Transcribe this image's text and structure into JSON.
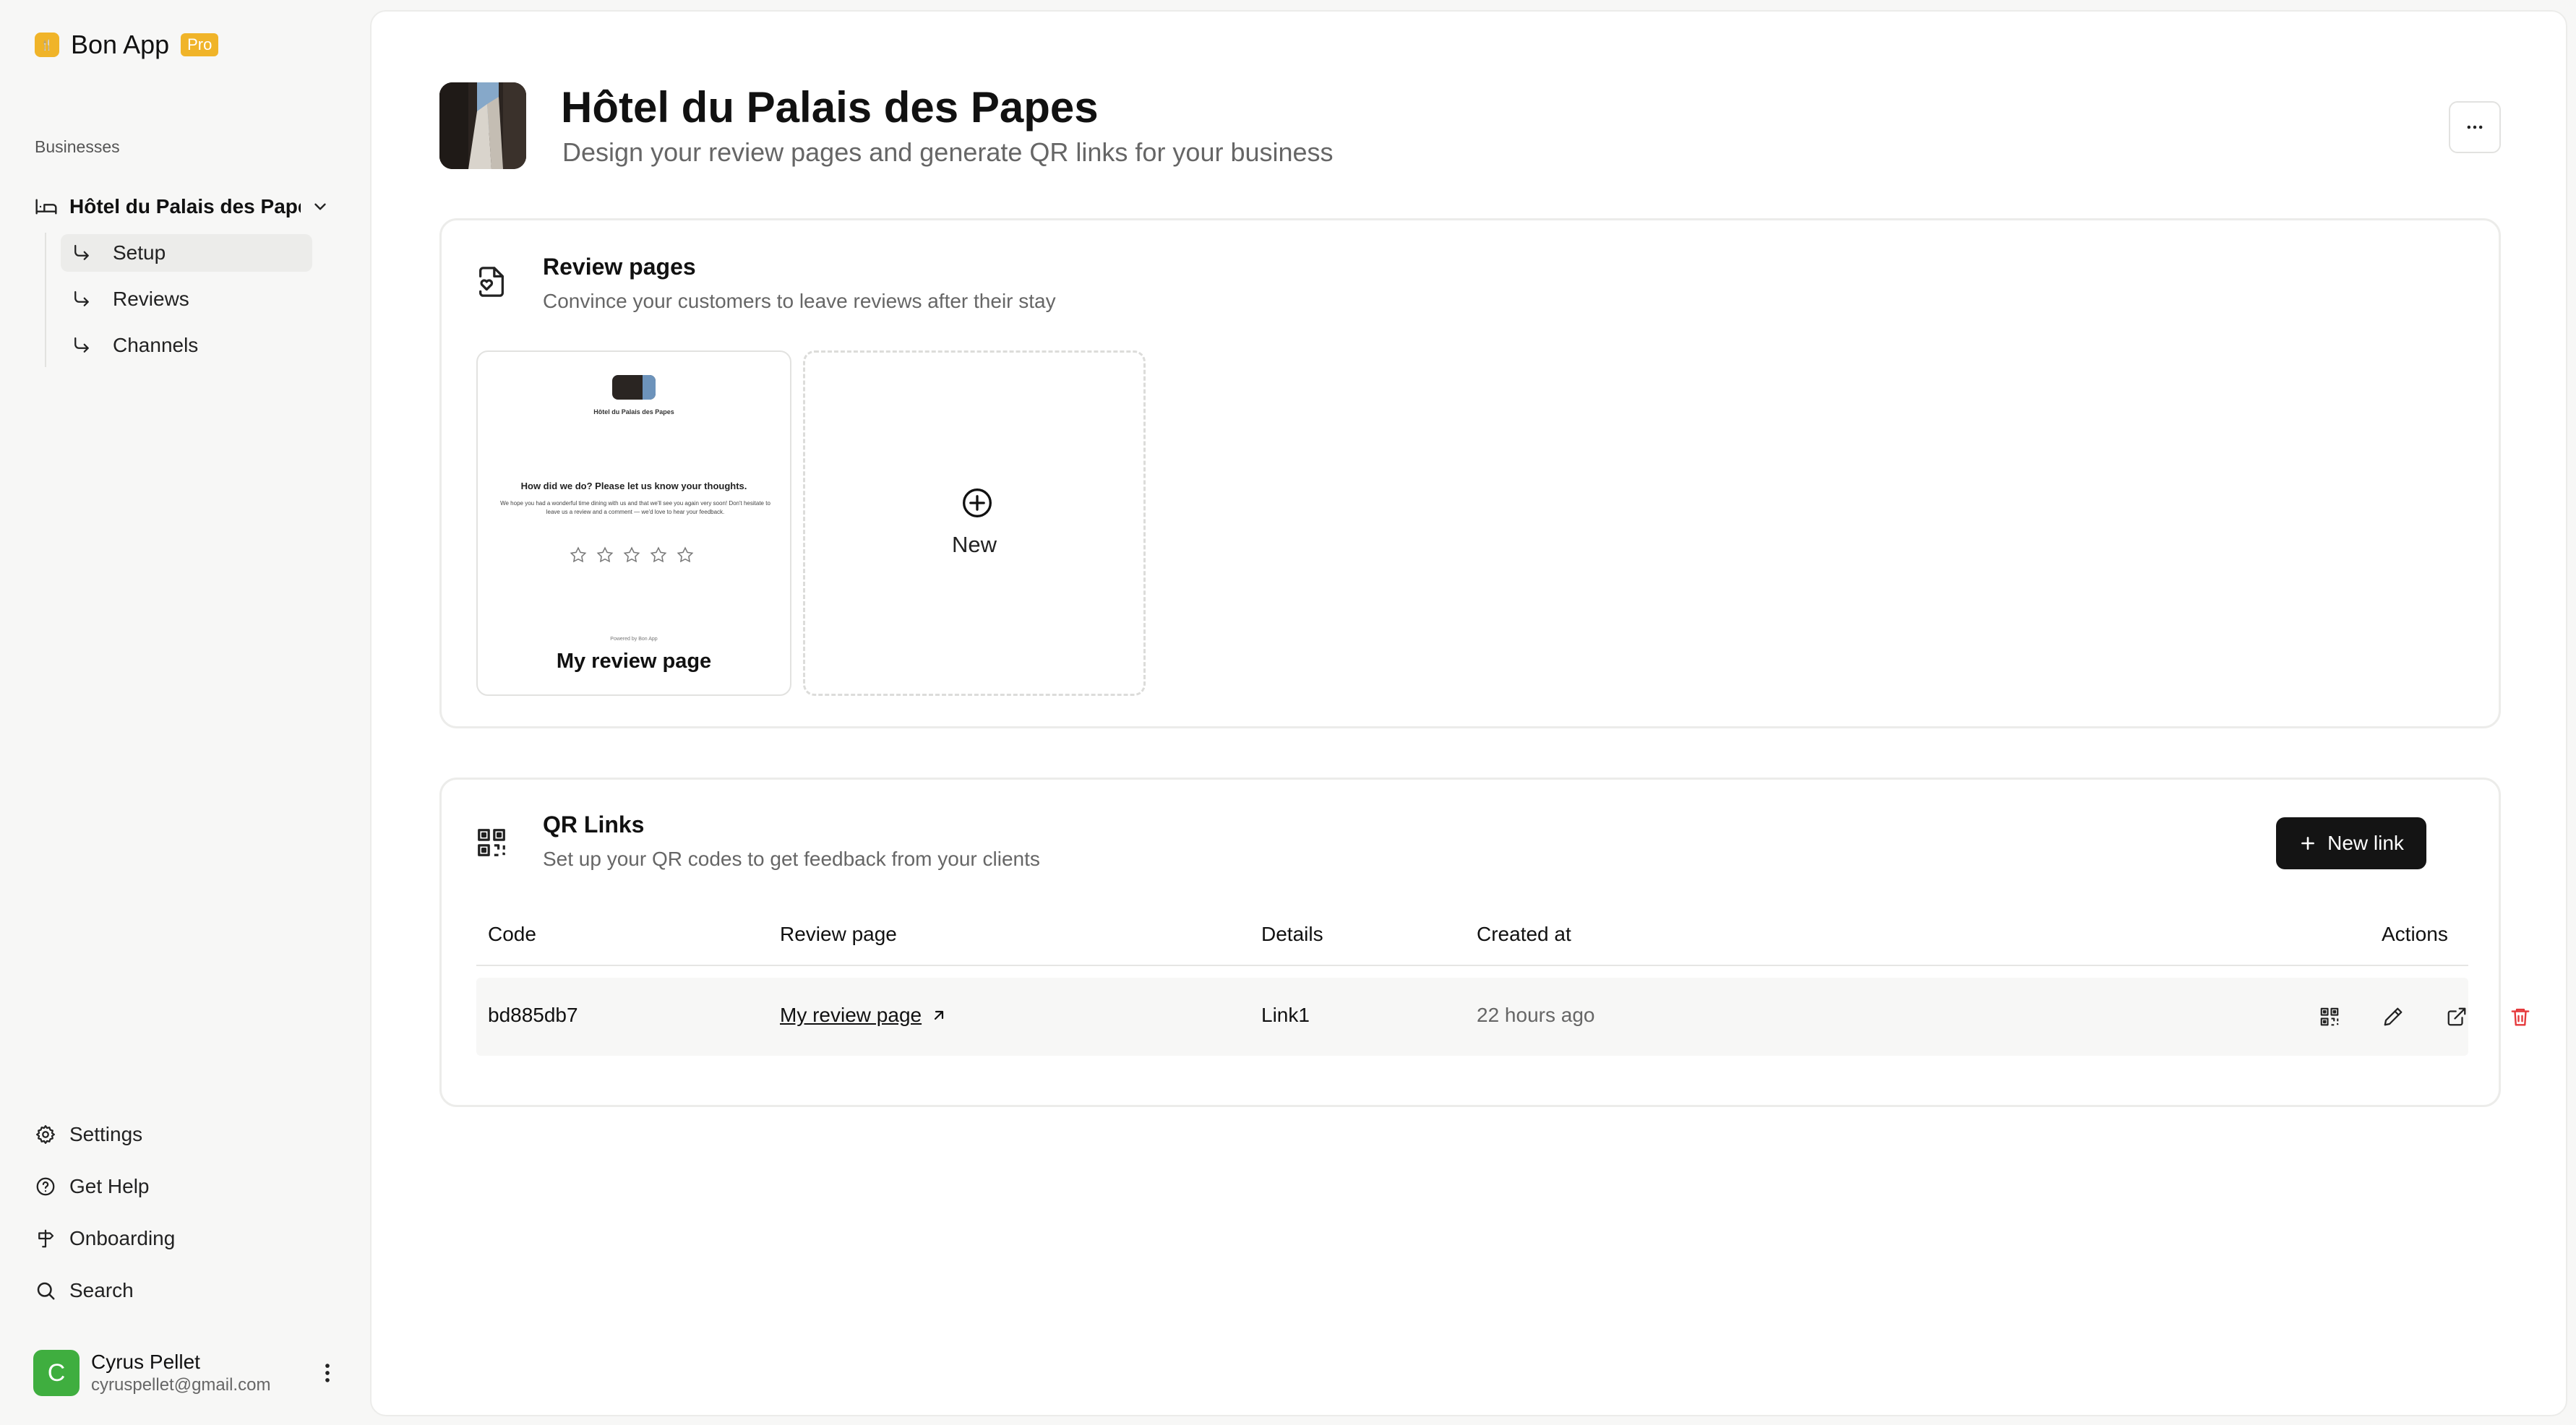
{
  "app": {
    "name": "Bon App",
    "badge": "Pro"
  },
  "colors": {
    "brand": "#f0b429",
    "danger": "#e5383b",
    "avatar": "#3fae3f",
    "primary_button": "#141414"
  },
  "sidebar": {
    "section_label": "Businesses",
    "business": {
      "name": "Hôtel du Palais des Papes",
      "icon": "bed-icon"
    },
    "items": [
      {
        "label": "Setup",
        "icon": "arrow-sub-icon",
        "active": true
      },
      {
        "label": "Reviews",
        "icon": "arrow-sub-icon"
      },
      {
        "label": "Channels",
        "icon": "arrow-sub-icon"
      }
    ],
    "bottom": [
      {
        "label": "Settings",
        "icon": "gear-icon"
      },
      {
        "label": "Get Help",
        "icon": "help-circle-icon"
      },
      {
        "label": "Onboarding",
        "icon": "signpost-icon"
      },
      {
        "label": "Search",
        "icon": "search-icon"
      }
    ],
    "user": {
      "initial": "C",
      "name": "Cyrus Pellet",
      "email": "cyruspellet@gmail.com"
    }
  },
  "header": {
    "title": "Hôtel du Palais des Papes",
    "subtitle": "Design your review pages and generate QR links for your business"
  },
  "review_pages": {
    "title": "Review pages",
    "description": "Convince your customers to leave reviews after their stay",
    "pages": [
      {
        "label": "My review page",
        "preview": {
          "business_name": "Hôtel du Palais des Papes",
          "question": "How did we do? Please let us know your thoughts.",
          "body": "We hope you had a wonderful time dining with us and that we'll see you again very soon! Don't hesitate to leave us a review and a comment — we'd love to hear your feedback.",
          "stars": 5,
          "footer": "Powered by Bon App"
        }
      }
    ],
    "new_label": "New"
  },
  "qr_links": {
    "title": "QR Links",
    "description": "Set up your QR codes to get feedback from your clients",
    "new_button": "New link",
    "columns": {
      "code": "Code",
      "review_page": "Review page",
      "details": "Details",
      "created_at": "Created at",
      "actions": "Actions"
    },
    "rows": [
      {
        "code": "bd885db7",
        "review_page": "My review page",
        "details": "Link1",
        "created_at": "22 hours ago"
      }
    ]
  }
}
